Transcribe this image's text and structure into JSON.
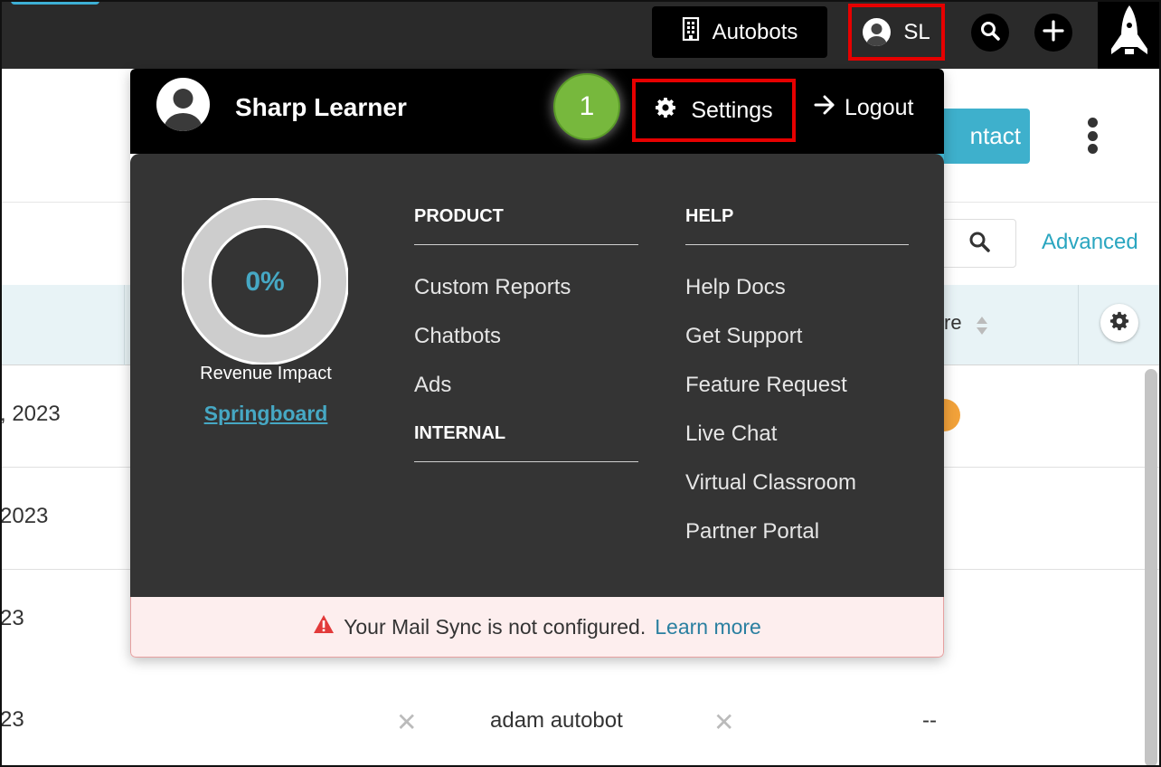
{
  "topbar": {
    "org_label": "Autobots",
    "user_initials": "SL"
  },
  "background": {
    "contact_button": "ntact",
    "advanced_link": "Advanced",
    "column_header_partial": "re",
    "rows": [
      {
        "date": ", 2023"
      },
      {
        "date": "2023"
      },
      {
        "date": "23"
      },
      {
        "date": "23",
        "owner": "adam autobot",
        "value": "--"
      }
    ]
  },
  "dropdown": {
    "user_name": "Sharp Learner",
    "step_badge": "1",
    "settings_label": "Settings",
    "logout_label": "Logout",
    "revenue": {
      "percent": "0%",
      "label": "Revenue Impact",
      "link": "Springboard"
    },
    "product": {
      "heading": "PRODUCT",
      "items": [
        "Custom Reports",
        "Chatbots",
        "Ads"
      ]
    },
    "internal": {
      "heading": "INTERNAL"
    },
    "help": {
      "heading": "HELP",
      "items": [
        "Help Docs",
        "Get Support",
        "Feature Request",
        "Live Chat",
        "Virtual Classroom",
        "Partner Portal"
      ]
    },
    "alert": {
      "message": "Your Mail Sync is not configured.",
      "link": "Learn more"
    }
  },
  "colors": {
    "topbar": "#2a2a2a",
    "accent_teal": "#3eb0cc",
    "highlight_red": "#e60000",
    "badge_green": "#77b83d",
    "menu_bg": "#343434"
  }
}
